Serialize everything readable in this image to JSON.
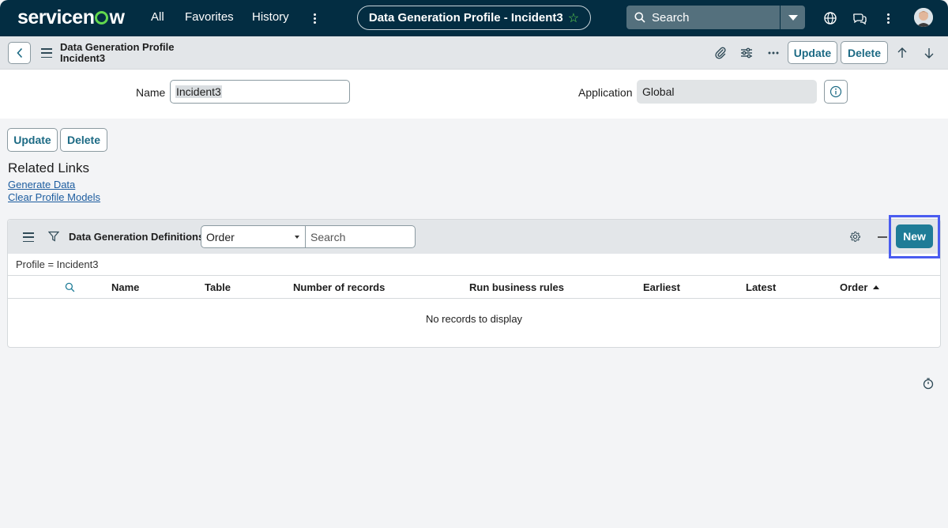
{
  "nav": {
    "brand": "servicenow",
    "links": [
      "All",
      "Favorites",
      "History"
    ],
    "context_title": "Data Generation Profile - Incident3",
    "search_placeholder": "Search",
    "icons": [
      "globe-icon",
      "chat-icon",
      "more-icon",
      "avatar"
    ]
  },
  "form_header": {
    "title_line1": "Data Generation Profile",
    "title_line2": "Incident3",
    "update_label": "Update",
    "delete_label": "Delete",
    "icons": [
      "attachment-icon",
      "settings-sliders-icon",
      "more-icon",
      "arrow-up-icon",
      "arrow-down-icon"
    ]
  },
  "fields": {
    "name_label": "Name",
    "name_value": "Incident3",
    "application_label": "Application",
    "application_value": "Global"
  },
  "actions": {
    "update_label": "Update",
    "delete_label": "Delete"
  },
  "related_links": {
    "heading": "Related Links",
    "links": [
      "Generate Data",
      "Clear Profile Models"
    ]
  },
  "related_list": {
    "title": "Data Generation Definitions",
    "select_value": "Order",
    "search_placeholder": "Search",
    "new_label": "New",
    "filter": "Profile = Incident3",
    "columns": [
      "Name",
      "Table",
      "Number of records",
      "Run business rules",
      "Earliest",
      "Latest",
      "Order"
    ],
    "sorted_column": "Order",
    "sort_direction": "ascending",
    "empty_message": "No records to display"
  },
  "colors": {
    "nav_bg": "#032d42",
    "accent": "#62d84e",
    "primary_button": "#1f7c97",
    "highlight": "#4a5cf0"
  }
}
